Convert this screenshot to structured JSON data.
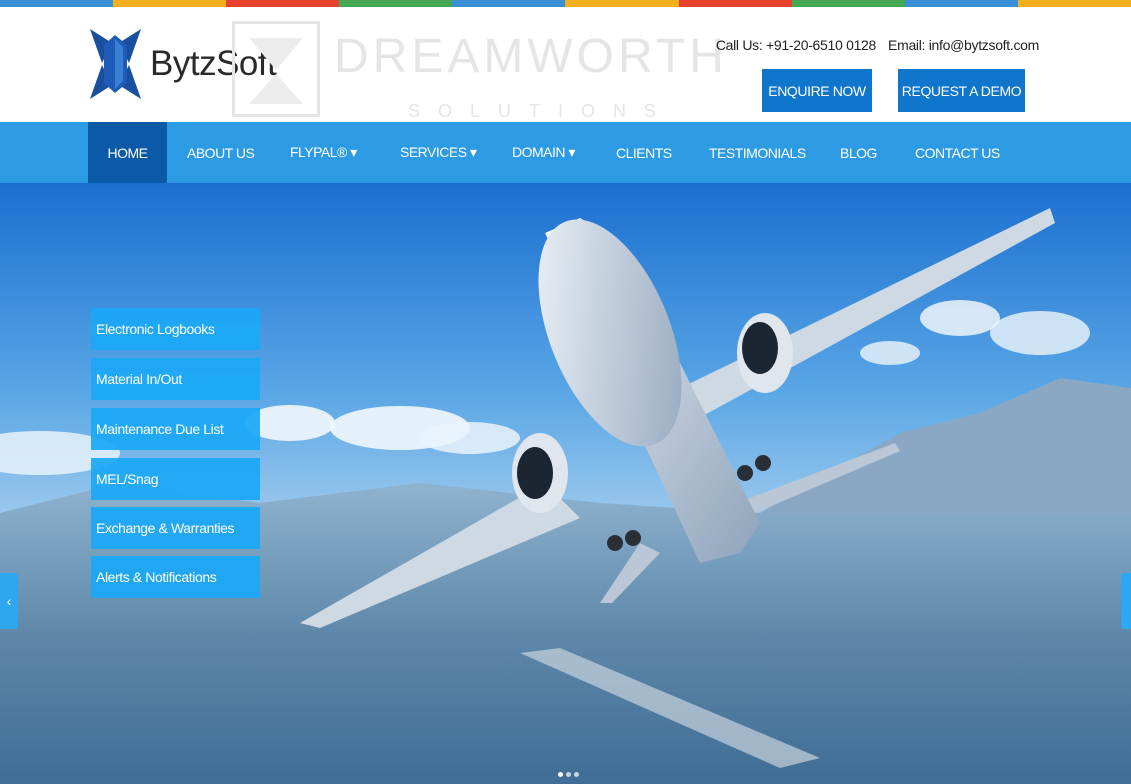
{
  "colors": {
    "top_strip": [
      "#3b8fd6",
      "#f2b01e",
      "#e8402f",
      "#44a853",
      "#3b8fd6",
      "#f2b01e",
      "#e8402f",
      "#44a853",
      "#3b8fd6",
      "#f2b01e"
    ],
    "nav_background": "#2c9be4",
    "nav_active": "#0a5aa8",
    "button_background": "#0f76cc",
    "menu_item_background": "#1ba8f6"
  },
  "header": {
    "logo": {
      "brand": "BytzSoft",
      "registered_mark": "®"
    },
    "watermark": {
      "title": "DREAMWORTH",
      "subtitle": "SOLUTIONS"
    },
    "contact": {
      "phone": "Call Us: +91-20-6510 0128",
      "email": "Email: info@bytzsoft.com"
    },
    "buttons": {
      "enquire": "ENQUIRE NOW",
      "demo": "REQUEST A DEMO"
    }
  },
  "nav": {
    "items": [
      {
        "label": "HOME",
        "active": true
      },
      {
        "label": "ABOUT US"
      },
      {
        "label": "FLYPAL® ▾"
      },
      {
        "label": "SERVICES ▾"
      },
      {
        "label": "DOMAIN ▾"
      },
      {
        "label": "CLIENTS"
      },
      {
        "label": "TESTIMONIALS"
      },
      {
        "label": "BLOG"
      },
      {
        "label": "CONTACT US"
      }
    ]
  },
  "hero": {
    "menu": [
      {
        "label": "Electronic Logbooks"
      },
      {
        "label": "Material In/Out"
      },
      {
        "label": "Maintenance Due List"
      },
      {
        "label": "MEL/Snag"
      },
      {
        "label": "Exchange & Warranties"
      },
      {
        "label": "Alerts & Notifications"
      }
    ],
    "prev_arrow": "‹",
    "slides": 3,
    "active_slide": 1
  }
}
